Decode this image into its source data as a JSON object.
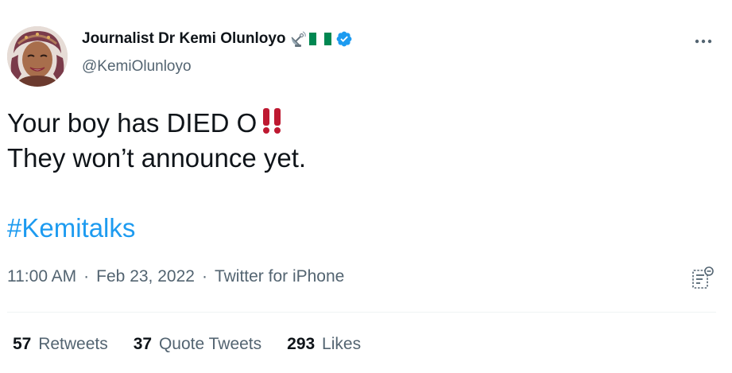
{
  "author": {
    "display_name": "Journalist Dr Kemi Olunloyo",
    "handle": "@KemiOlunloyo",
    "name_emojis": [
      "satellite-antenna-icon",
      "nigeria-flag-icon"
    ],
    "verified": true
  },
  "tweet": {
    "line1": "Your boy has DIED O",
    "line1_emoji": "double-exclamation-icon",
    "line2": "They won’t announce yet.",
    "hashtag": "#Kemitalks"
  },
  "meta": {
    "time": "11:00 AM",
    "separator": "·",
    "date": "Feb 23, 2022",
    "source": "Twitter for iPhone"
  },
  "stats": {
    "retweets_count": "57",
    "retweets_label": "Retweets",
    "quote_count": "37",
    "quote_label": "Quote Tweets",
    "likes_count": "293",
    "likes_label": "Likes"
  },
  "colors": {
    "text_primary": "#0f1419",
    "text_secondary": "#536471",
    "link": "#1d9bf0",
    "verified": "#1d9bf0",
    "emoji_red": "#be1931",
    "flag_green": "#008751",
    "divider": "#eff3f4"
  }
}
